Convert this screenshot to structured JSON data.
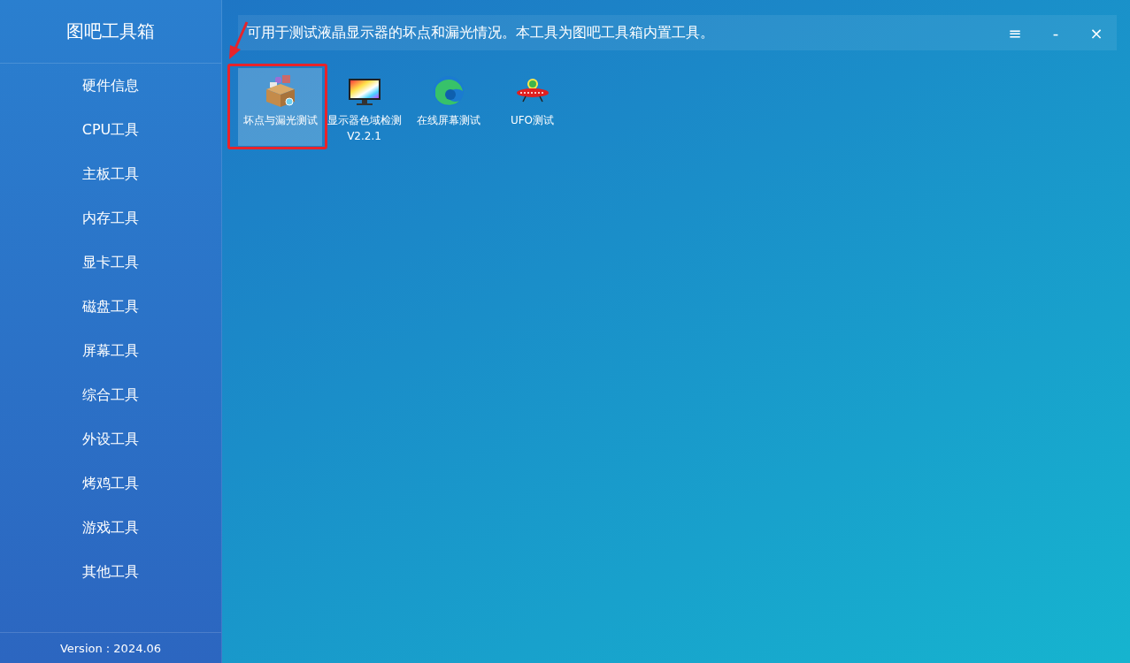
{
  "app": {
    "title": "图吧工具箱",
    "version": "Version : 2024.06"
  },
  "sidebar": {
    "items": [
      {
        "label": "硬件信息"
      },
      {
        "label": "CPU工具"
      },
      {
        "label": "主板工具"
      },
      {
        "label": "内存工具"
      },
      {
        "label": "显卡工具"
      },
      {
        "label": "磁盘工具"
      },
      {
        "label": "屏幕工具"
      },
      {
        "label": "综合工具"
      },
      {
        "label": "外设工具"
      },
      {
        "label": "烤鸡工具"
      },
      {
        "label": "游戏工具"
      },
      {
        "label": "其他工具"
      }
    ]
  },
  "description": "可用于测试液晶显示器的坏点和漏光情况。本工具为图吧工具箱内置工具。",
  "window_controls": [
    "≡",
    "-",
    "×"
  ],
  "tools": [
    {
      "kind": "box",
      "label": "坏点与漏光测试",
      "selected": true,
      "annotated": true
    },
    {
      "kind": "monitor",
      "label": "显示器色域检测V2.2.1",
      "selected": false,
      "annotated": false
    },
    {
      "kind": "globe",
      "label": "在线屏幕测试",
      "selected": false,
      "annotated": false
    },
    {
      "kind": "ufo",
      "label": "UFO测试",
      "selected": false,
      "annotated": false
    }
  ]
}
